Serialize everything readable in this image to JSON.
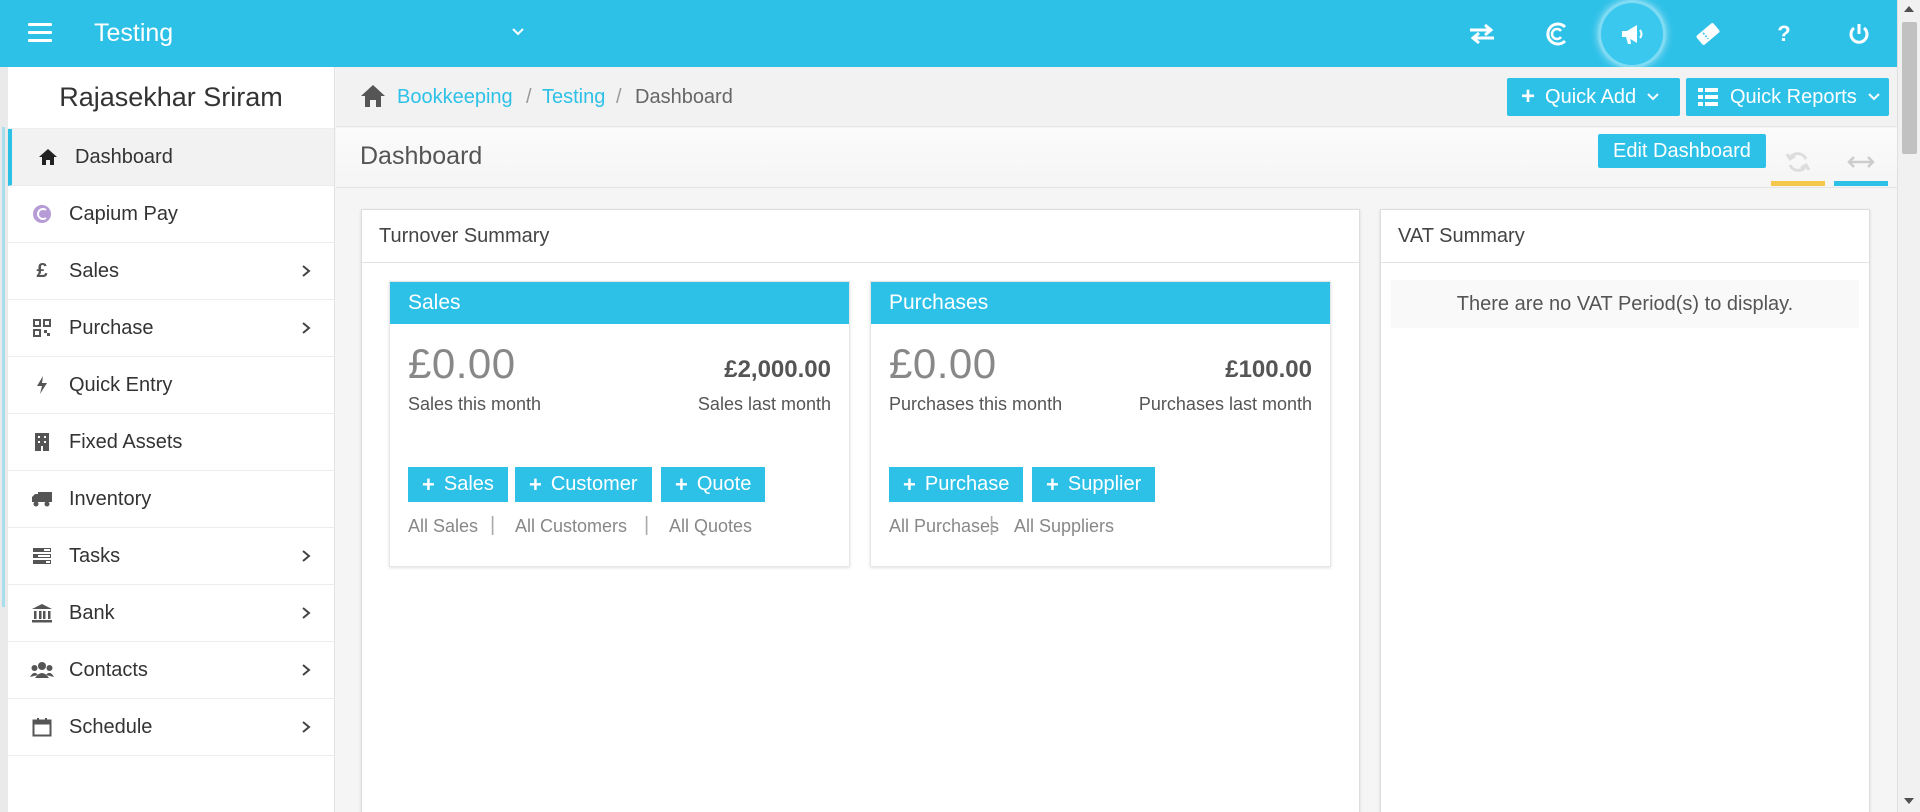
{
  "app": {
    "title": "Testing"
  },
  "user": {
    "name": "Rajasekhar Sriram"
  },
  "sidebar": {
    "items": [
      {
        "label": "Dashboard",
        "icon": "home-icon"
      },
      {
        "label": "Capium Pay",
        "icon": "capium-pay-icon"
      },
      {
        "label": "Sales",
        "icon": "pound-icon"
      },
      {
        "label": "Purchase",
        "icon": "qrcode-icon"
      },
      {
        "label": "Quick Entry",
        "icon": "bolt-icon"
      },
      {
        "label": "Fixed Assets",
        "icon": "building-icon"
      },
      {
        "label": "Inventory",
        "icon": "truck-icon"
      },
      {
        "label": "Tasks",
        "icon": "tasks-icon"
      },
      {
        "label": "Bank",
        "icon": "bank-icon"
      },
      {
        "label": "Contacts",
        "icon": "users-icon"
      },
      {
        "label": "Schedule",
        "icon": "calendar-icon"
      }
    ]
  },
  "breadcrumb": {
    "root": "Bookkeeping",
    "sep": "/",
    "client": "Testing",
    "current": "Dashboard"
  },
  "toolbar": {
    "quick_add": "Quick Add",
    "quick_reports": "Quick Reports",
    "edit_dashboard": "Edit Dashboard"
  },
  "page": {
    "title": "Dashboard"
  },
  "turnover": {
    "title": "Turnover Summary",
    "sales": {
      "header": "Sales",
      "this_month_amount": "£0.00",
      "this_month_label": "Sales this month",
      "last_month_amount": "£2,000.00",
      "last_month_label": "Sales last month",
      "buttons": [
        "Sales",
        "Customer",
        "Quote"
      ],
      "links": [
        "All Sales",
        "All Customers",
        "All Quotes"
      ]
    },
    "purchases": {
      "header": "Purchases",
      "this_month_amount": "£0.00",
      "this_month_label": "Purchases this month",
      "last_month_amount": "£100.00",
      "last_month_label": "Purchases last month",
      "buttons": [
        "Purchase",
        "Supplier"
      ],
      "links": [
        "All Purchases",
        "All Suppliers"
      ]
    },
    "link_separator": "|"
  },
  "vat": {
    "title": "VAT Summary",
    "empty_message": "There are no VAT Period(s) to display."
  },
  "icons": {
    "help": "?",
    "plus": "+"
  },
  "colors": {
    "brand": "#2ec1e8",
    "accent_yellow": "#f5c84c"
  }
}
